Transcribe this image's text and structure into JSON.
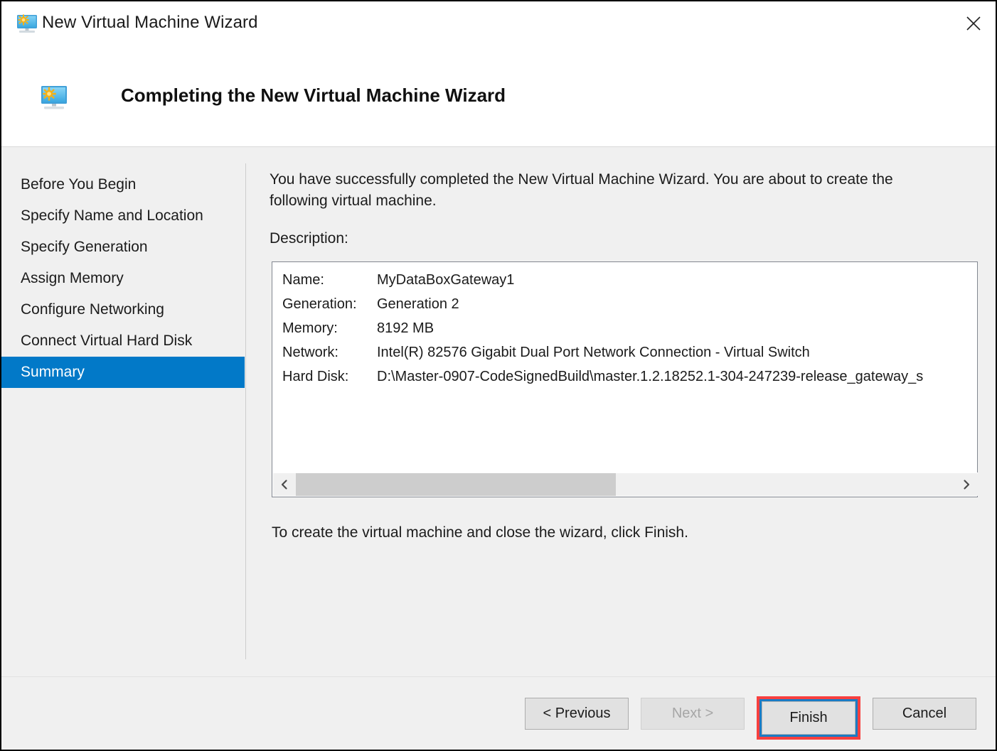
{
  "window": {
    "title": "New Virtual Machine Wizard",
    "title_icon": "virtual-machine-monitor-icon",
    "close_label": "✕"
  },
  "banner": {
    "heading": "Completing the New Virtual Machine Wizard",
    "icon": "virtual-machine-monitor-icon"
  },
  "sidebar": {
    "items": [
      {
        "label": "Before You Begin",
        "selected": false
      },
      {
        "label": "Specify Name and Location",
        "selected": false
      },
      {
        "label": "Specify Generation",
        "selected": false
      },
      {
        "label": "Assign Memory",
        "selected": false
      },
      {
        "label": "Configure Networking",
        "selected": false
      },
      {
        "label": "Connect Virtual Hard Disk",
        "selected": false
      },
      {
        "label": "Summary",
        "selected": true
      }
    ]
  },
  "main": {
    "intro": "You have successfully completed the New Virtual Machine Wizard. You are about to create the following virtual machine.",
    "description_label": "Description:",
    "details": [
      {
        "key": "Name:",
        "value": "MyDataBoxGateway1"
      },
      {
        "key": "Generation:",
        "value": "Generation 2"
      },
      {
        "key": "Memory:",
        "value": "8192 MB"
      },
      {
        "key": "Network:",
        "value": "Intel(R) 82576 Gigabit Dual Port Network Connection - Virtual Switch"
      },
      {
        "key": "Hard Disk:",
        "value": "D:\\Master-0907-CodeSignedBuild\\master.1.2.18252.1-304-247239-release_gateway_s"
      }
    ],
    "scrollbar": {
      "left_arrow": "‹",
      "right_arrow": "›"
    },
    "closing_text": "To create the virtual machine and close the wizard, click Finish."
  },
  "footer": {
    "previous_label": "< Previous",
    "next_label": "Next >",
    "finish_label": "Finish",
    "cancel_label": "Cancel"
  },
  "colors": {
    "selection_blue": "#0279c8",
    "focus_blue": "#1a7bc4",
    "annotation_red": "#f8403f",
    "dialog_bg": "#f0f0f0"
  }
}
